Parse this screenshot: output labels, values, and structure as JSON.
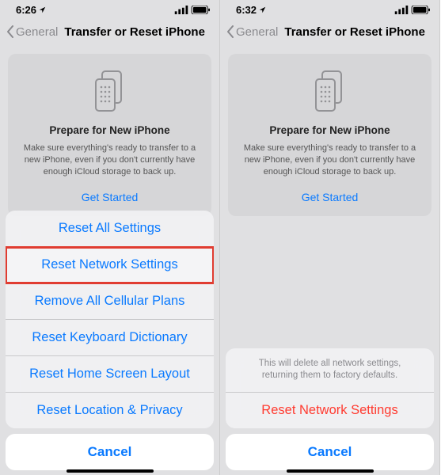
{
  "left": {
    "status": {
      "time": "6:26",
      "location_arrow": "↗"
    },
    "nav": {
      "back_label": "General",
      "title": "Transfer or Reset iPhone"
    },
    "card": {
      "title": "Prepare for New iPhone",
      "desc": "Make sure everything's ready to transfer to a new iPhone, even if you don't currently have enough iCloud storage to back up.",
      "cta": "Get Started"
    },
    "sheet": {
      "options": [
        "Reset All Settings",
        "Reset Network Settings",
        "Remove All Cellular Plans",
        "Reset Keyboard Dictionary",
        "Reset Home Screen Layout",
        "Reset Location & Privacy"
      ],
      "highlighted_index": 1,
      "cancel": "Cancel"
    }
  },
  "right": {
    "status": {
      "time": "6:32",
      "location_arrow": "↗"
    },
    "nav": {
      "back_label": "General",
      "title": "Transfer or Reset iPhone"
    },
    "card": {
      "title": "Prepare for New iPhone",
      "desc": "Make sure everything's ready to transfer to a new iPhone, even if you don't currently have enough iCloud storage to back up.",
      "cta": "Get Started"
    },
    "sheet": {
      "warning": "This will delete all network settings, returning them to factory defaults.",
      "confirm": "Reset Network Settings",
      "cancel": "Cancel"
    }
  }
}
